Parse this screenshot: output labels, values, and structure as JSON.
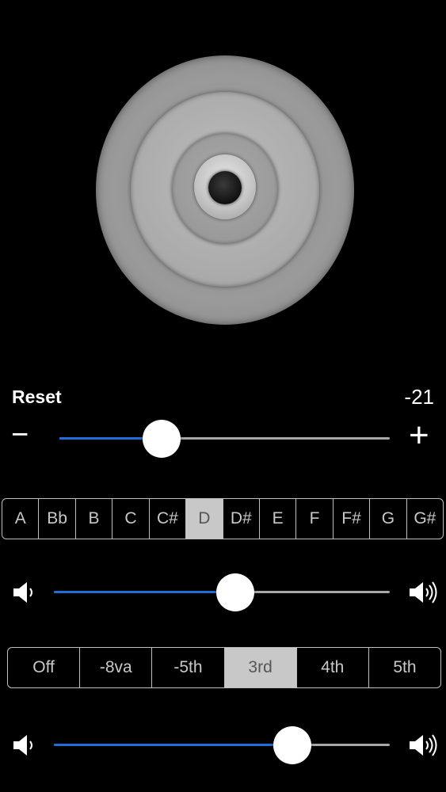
{
  "transpose": {
    "reset_label": "Reset",
    "value": "-21",
    "minus_symbol": "−",
    "plus_symbol": "+",
    "level": 0.31
  },
  "notes": {
    "options": [
      "A",
      "Bb",
      "B",
      "C",
      "C#",
      "D",
      "D#",
      "E",
      "F",
      "F#",
      "G",
      "G#"
    ],
    "selected": "D"
  },
  "volume_1": {
    "level": 0.54
  },
  "harmony": {
    "options": [
      "Off",
      "-8va",
      "-5th",
      "3rd",
      "4th",
      "5th"
    ],
    "selected": "3rd"
  },
  "volume_2": {
    "level": 0.71
  },
  "colors": {
    "accent": "#1e6fd9",
    "selected_segment": "#c8c8c8",
    "background": "#000000"
  },
  "icons": {
    "volume_low": "speaker-low-icon",
    "volume_high": "speaker-high-icon"
  }
}
